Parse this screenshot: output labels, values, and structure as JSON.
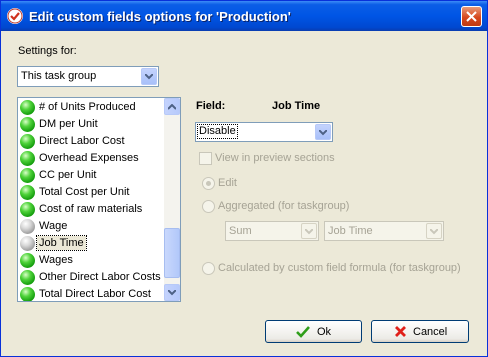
{
  "window": {
    "title": "Edit custom fields options for  'Production'",
    "title_icon": "checkmark-app-icon",
    "close_icon": "close-icon"
  },
  "settings": {
    "label": "Settings for:",
    "selected": "This task group"
  },
  "fields_list": {
    "items": [
      {
        "label": "# of Units Produced",
        "status": "green"
      },
      {
        "label": "DM per Unit",
        "status": "green"
      },
      {
        "label": "Direct Labor Cost",
        "status": "green"
      },
      {
        "label": "Overhead Expenses",
        "status": "green"
      },
      {
        "label": "CC per Unit",
        "status": "green"
      },
      {
        "label": "Total Cost per Unit",
        "status": "green"
      },
      {
        "label": "Cost of raw materials",
        "status": "green"
      },
      {
        "label": "Wage",
        "status": "gray"
      },
      {
        "label": "Job Time",
        "status": "gray"
      },
      {
        "label": "Wages",
        "status": "green"
      },
      {
        "label": "Other Direct Labor Costs",
        "status": "green"
      },
      {
        "label": "Total Direct Labor Cost",
        "status": "green"
      }
    ],
    "selected_index": 8
  },
  "field": {
    "label": "Field:",
    "name": "Job Time",
    "mode": "Disable"
  },
  "options": {
    "view_in_preview": "View in preview sections",
    "edit": "Edit",
    "aggregated": "Aggregated (for taskgroup)",
    "agg_function": "Sum",
    "agg_field": "Job Time",
    "calculated": "Calculated by custom field formula (for taskgroup)"
  },
  "buttons": {
    "ok": "Ok",
    "cancel": "Cancel"
  },
  "colors": {
    "titlebar": "#0055e5",
    "dialog_bg": "#ece9d8",
    "status_green": "#1fae14",
    "status_gray": "#9a9a9a",
    "cancel_x": "#e0201a",
    "ok_check": "#2f9e1a"
  }
}
